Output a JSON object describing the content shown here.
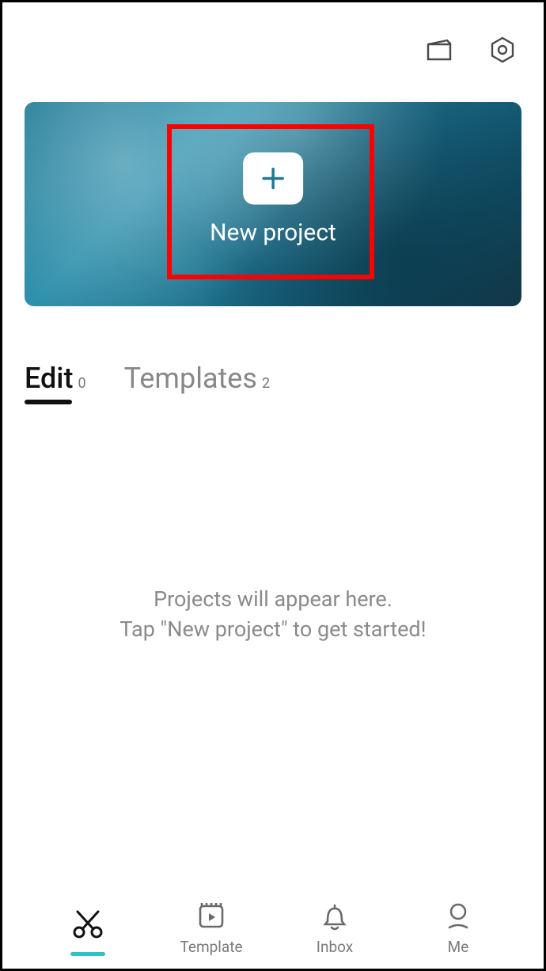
{
  "hero": {
    "new_project_label": "New project"
  },
  "tabs": {
    "edit": {
      "label": "Edit",
      "count": "0"
    },
    "templates": {
      "label": "Templates",
      "count": "2"
    }
  },
  "empty_state": {
    "line1": "Projects will appear here.",
    "line2": "Tap \"New project\" to get started!"
  },
  "bottom_nav": {
    "edit": "",
    "template": "Template",
    "inbox": "Inbox",
    "me": "Me"
  }
}
